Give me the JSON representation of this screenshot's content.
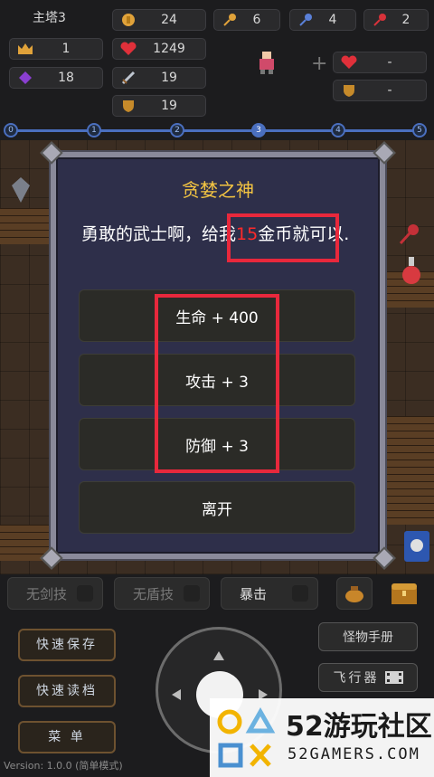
{
  "stats": {
    "floor": "主塔3",
    "level": "1",
    "exp": "18",
    "gold": "24",
    "hp": "1249",
    "attack": "19",
    "defense": "19",
    "yellow_keys": "6",
    "blue_keys": "4",
    "red_keys": "2",
    "slot_hp": "-",
    "slot_def": "-"
  },
  "progress": {
    "nodes": [
      "0",
      "1",
      "2",
      "3",
      "4",
      "5"
    ],
    "active_index": 3
  },
  "dialog": {
    "title": "贪婪之神",
    "text_before": "勇敢的武士啊，给我",
    "gold_amount": "15",
    "text_after": "金币就可以.",
    "options": [
      "生命 + 400",
      "攻击 + 3",
      "防御 + 3"
    ],
    "leave": "离开"
  },
  "skills": {
    "sword": "无剑技",
    "shield": "无盾技",
    "crit": "暴击"
  },
  "buttons": {
    "quick_save": "快速保存",
    "quick_load": "快速读档",
    "menu": "菜 单",
    "monster_book": "怪物手册",
    "flyer": "飞行器"
  },
  "version": "Version: 1.0.0 (简单模式)",
  "watermark": {
    "main": "52游玩社区",
    "sub": "52GAMERS.COM"
  },
  "colors": {
    "accent_red": "#e8283c",
    "title_gold": "#f4c542",
    "progress_blue": "#4a6fbf"
  }
}
